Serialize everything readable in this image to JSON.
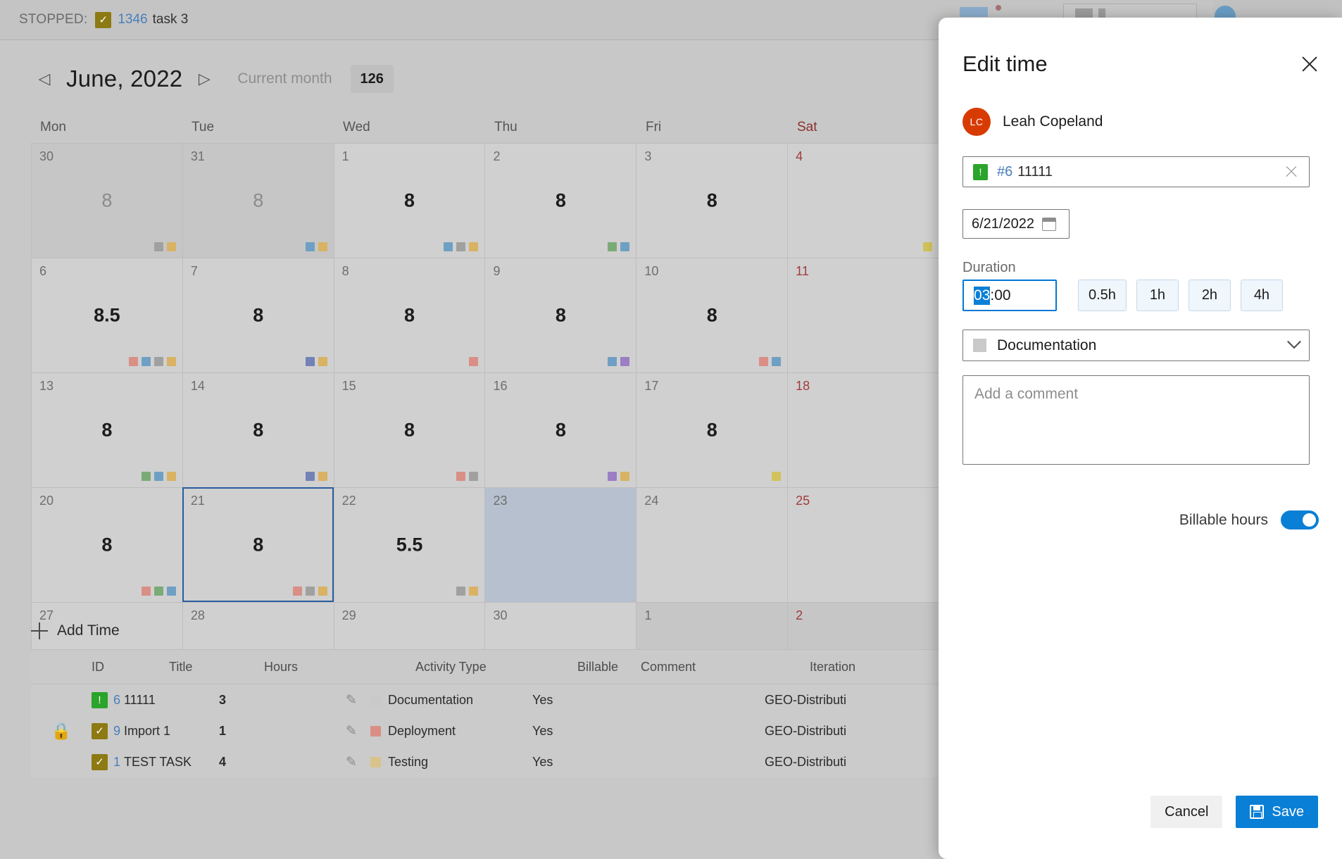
{
  "status_bar": {
    "label": "STOPPED:",
    "work_item_icon": "task-checkbox-icon",
    "work_item_id": "1346",
    "work_item_title": "task 3"
  },
  "month_bar": {
    "prev_icon": "chevron-left-icon",
    "next_icon": "chevron-right-icon",
    "title": "June, 2022",
    "current_month_label": "Current month",
    "month_total": "126"
  },
  "calendar": {
    "day_headers": [
      "Mon",
      "Tue",
      "Wed",
      "Thu",
      "Fri",
      "Sat"
    ],
    "weeks": [
      [
        {
          "num": "30",
          "hours": "8",
          "outside": true,
          "dots": [
            "#a0a0a0",
            "#d9b263"
          ]
        },
        {
          "num": "31",
          "hours": "8",
          "outside": true,
          "dots": [
            "#6fa0c4",
            "#d9b263"
          ]
        },
        {
          "num": "1",
          "hours": "8",
          "outside": false,
          "dots": [
            "#6fa0c4",
            "#a0a0a0",
            "#d9b263"
          ]
        },
        {
          "num": "2",
          "hours": "8",
          "outside": false,
          "dots": [
            "#7aab77",
            "#6fa0c4"
          ]
        },
        {
          "num": "3",
          "hours": "8",
          "outside": false,
          "dots": []
        },
        {
          "num": "4",
          "hours": "",
          "outside": false,
          "weekend": true,
          "dots": [
            "#d2c35a"
          ]
        }
      ],
      [
        {
          "num": "6",
          "hours": "8.5",
          "outside": false,
          "dots": [
            "#d98f85",
            "#6fa0c4",
            "#a0a0a0",
            "#d9b263"
          ]
        },
        {
          "num": "7",
          "hours": "8",
          "outside": false,
          "dots": [
            "#7382b5",
            "#d9b263"
          ]
        },
        {
          "num": "8",
          "hours": "8",
          "outside": false,
          "dots": [
            "#d98f85"
          ]
        },
        {
          "num": "9",
          "hours": "8",
          "outside": false,
          "dots": [
            "#6fa0c4",
            "#9b7ec4"
          ]
        },
        {
          "num": "10",
          "hours": "8",
          "outside": false,
          "dots": [
            "#d98f85",
            "#6fa0c4"
          ]
        },
        {
          "num": "11",
          "hours": "",
          "outside": false,
          "weekend": true,
          "dots": []
        }
      ],
      [
        {
          "num": "13",
          "hours": "8",
          "outside": false,
          "dots": [
            "#7aab77",
            "#6fa0c4",
            "#d9b263"
          ]
        },
        {
          "num": "14",
          "hours": "8",
          "outside": false,
          "dots": [
            "#7382b5",
            "#d9b263"
          ]
        },
        {
          "num": "15",
          "hours": "8",
          "outside": false,
          "dots": [
            "#d98f85",
            "#a0a0a0"
          ]
        },
        {
          "num": "16",
          "hours": "8",
          "outside": false,
          "dots": [
            "#9b7ec4",
            "#d9b263"
          ]
        },
        {
          "num": "17",
          "hours": "8",
          "outside": false,
          "dots": [
            "#d2c35a"
          ]
        },
        {
          "num": "18",
          "hours": "",
          "outside": false,
          "weekend": true,
          "dots": []
        }
      ],
      [
        {
          "num": "20",
          "hours": "8",
          "outside": false,
          "dots": [
            "#d98f85",
            "#7aab77",
            "#6fa0c4"
          ]
        },
        {
          "num": "21",
          "hours": "8",
          "outside": false,
          "selected": true,
          "dots": [
            "#d98f85",
            "#a0a0a0",
            "#d9b263"
          ]
        },
        {
          "num": "22",
          "hours": "5.5",
          "outside": false,
          "dots": [
            "#a0a0a0",
            "#d9b263"
          ]
        },
        {
          "num": "23",
          "hours": "",
          "outside": false,
          "highlighted": true,
          "dots": []
        },
        {
          "num": "24",
          "hours": "",
          "outside": false,
          "dots": []
        },
        {
          "num": "25",
          "hours": "",
          "outside": false,
          "weekend": true,
          "dots": []
        }
      ],
      [
        {
          "num": "27",
          "hours": "",
          "outside": false,
          "dots": []
        },
        {
          "num": "28",
          "hours": "",
          "outside": false,
          "dots": []
        },
        {
          "num": "29",
          "hours": "",
          "outside": false,
          "dots": []
        },
        {
          "num": "30",
          "hours": "",
          "outside": false,
          "dots": []
        },
        {
          "num": "1",
          "hours": "",
          "outside": true,
          "dots": []
        },
        {
          "num": "2",
          "hours": "",
          "outside": true,
          "weekend": true,
          "dots": []
        }
      ]
    ]
  },
  "add_time": {
    "icon": "plus-icon",
    "label": "Add Time"
  },
  "time_table": {
    "columns": [
      "ID",
      "Title",
      "Hours",
      "Activity Type",
      "Billable",
      "Comment",
      "Iteration"
    ],
    "rows": [
      {
        "locked": false,
        "lock_icon": "",
        "type_icon": "issue-icon",
        "type_glyph": "!",
        "type_color": "#2aa42a",
        "id": "6",
        "title": "11111",
        "hours": "3",
        "edit_icon": "pencil-icon",
        "activity": "Documentation",
        "activity_color": "#c9c9c9",
        "billable": "Yes",
        "comment": "",
        "iteration": "GEO-Distributi"
      },
      {
        "locked": true,
        "lock_icon": "lock-icon",
        "type_icon": "task-icon",
        "type_glyph": "✓",
        "type_color": "#8d7a12",
        "id": "9",
        "title": "Import 1",
        "hours": "1",
        "edit_icon": "pencil-icon",
        "activity": "Deployment",
        "activity_color": "#d98f85",
        "billable": "Yes",
        "comment": "",
        "iteration": "GEO-Distributi"
      },
      {
        "locked": false,
        "lock_icon": "",
        "type_icon": "task-icon",
        "type_glyph": "✓",
        "type_color": "#8d7a12",
        "id": "1",
        "title": "TEST TASK",
        "hours": "4",
        "edit_icon": "pencil-icon",
        "activity": "Testing",
        "activity_color": "#d9c38a",
        "billable": "Yes",
        "comment": "",
        "iteration": "GEO-Distributi"
      }
    ]
  },
  "dialog": {
    "title": "Edit time",
    "close_icon": "close-icon",
    "user": {
      "initials": "LC",
      "name": "Leah Copeland",
      "avatar_color": "#d83b01"
    },
    "task_field": {
      "icon": "issue-icon",
      "icon_glyph": "!",
      "id": "#6",
      "title": "11111",
      "clear_icon": "clear-icon"
    },
    "date_field": {
      "value": "6/21/2022",
      "icon": "calendar-icon"
    },
    "duration": {
      "label": "Duration",
      "selected_part": "03",
      "rest_part": ":00",
      "quick_buttons": [
        "0.5h",
        "1h",
        "2h",
        "4h"
      ]
    },
    "activity": {
      "value": "Documentation",
      "swatch_color": "#c9c9c9",
      "chevron_icon": "chevron-down-icon"
    },
    "comment": {
      "placeholder": "Add a comment",
      "value": ""
    },
    "billable": {
      "label": "Billable hours",
      "on": true
    },
    "actions": {
      "cancel": "Cancel",
      "save": "Save",
      "save_icon": "save-floppy-icon"
    }
  }
}
